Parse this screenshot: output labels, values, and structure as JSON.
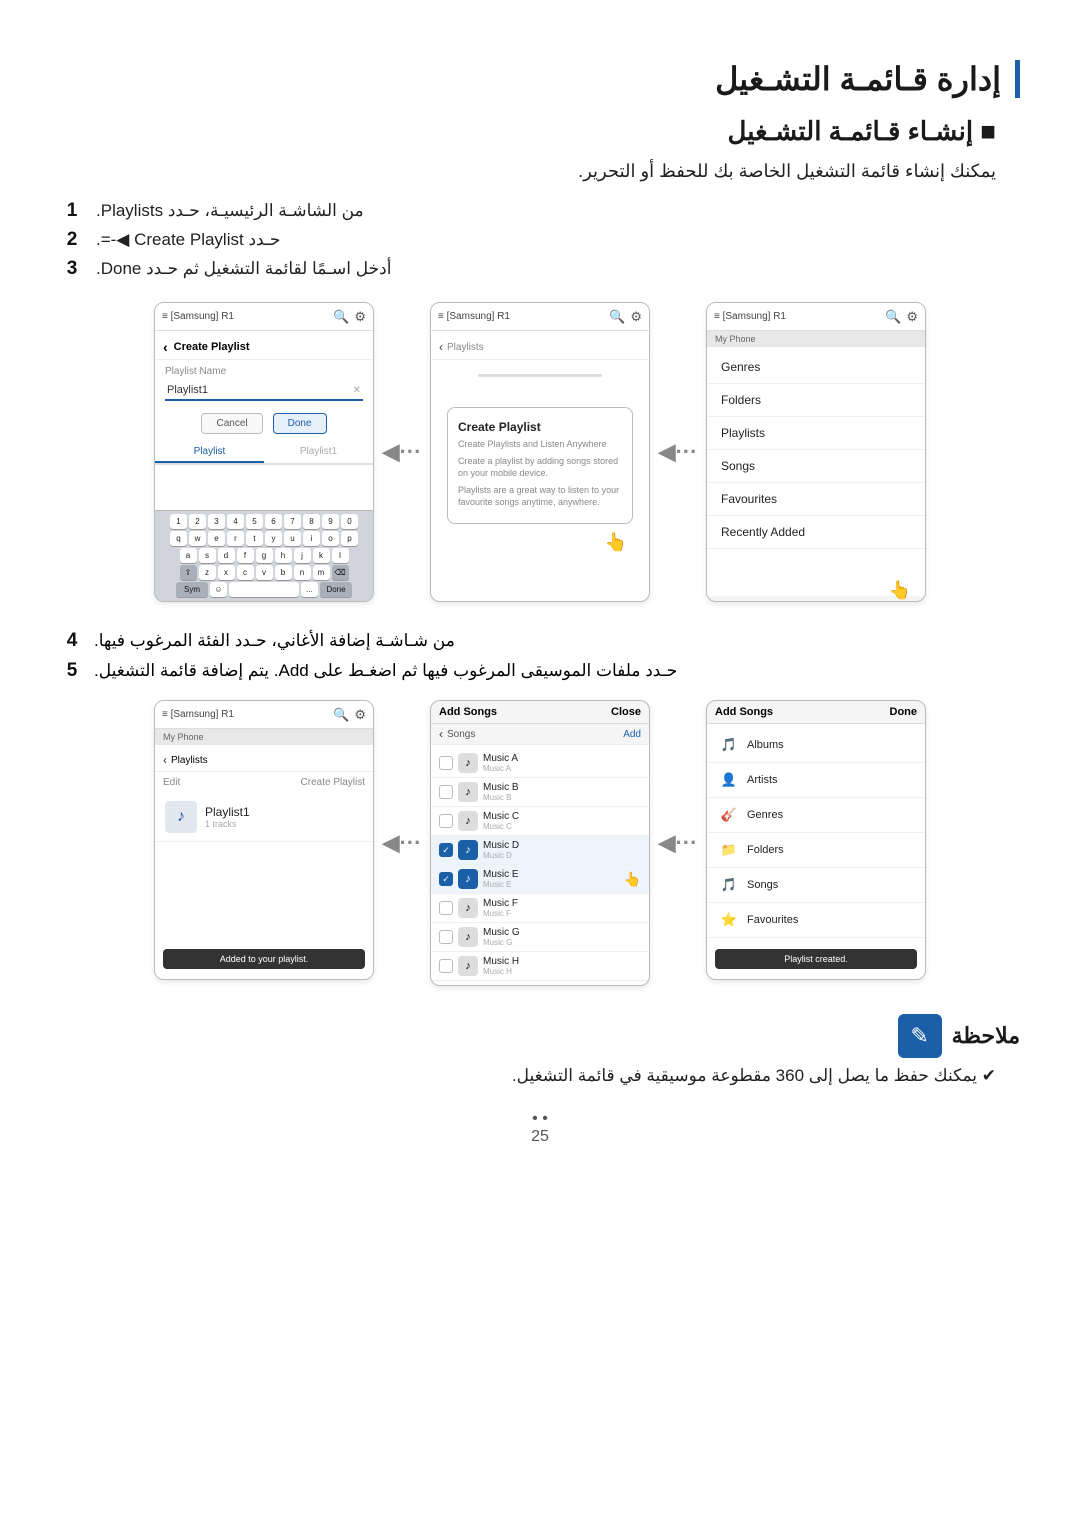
{
  "page": {
    "main_title": "إدارة قـائمـة التشـغيل",
    "section_title": "■ إنشـاء قـائمـة التشـغيل",
    "section_subtitle": "يمكنك إنشاء قائمة التشغيل الخاصة بك للحفظ أو التحرير.",
    "steps": [
      {
        "num": "1",
        "text": "من الشاشـة الرئيسيـة، حـدد Playlists."
      },
      {
        "num": "2",
        "text": "حـدد Create Playlist ◀-=."
      },
      {
        "num": "3",
        "text": "أدخل اسـمًا لقائمة التشغيل ثم حـدد Done."
      }
    ],
    "steps2": [
      {
        "num": "4",
        "text": "من شـاشـة إضافة الأغاني، حـدد الفئة المرغوب فيها."
      },
      {
        "num": "5",
        "text": "حـدد ملفات الموسيقى المرغوب فيها ثم اضغـط على Add. يتم إضافة قائمة التشغيل."
      }
    ],
    "note_label": "ملاحظة",
    "note_text": "✔ يمكنك حفظ ما يصل إلى 360 مقطوعة موسيقية في قائمة التشغيل.",
    "page_number": "25",
    "screen1": {
      "header": "≡ [Samsung] R1",
      "title": "Create Playlist",
      "label": "Playlist Name",
      "value": "Playlist1",
      "cancel": "Cancel",
      "done": "Done",
      "tab1": "Playlist",
      "tab2": "Playlist1"
    },
    "screen2": {
      "header": "≡ [Samsung] R1",
      "back": "< Playlists",
      "popup_title": "Create Playlist",
      "popup_sub1": "Create Playlists and Listen Anywhere",
      "popup_sub2": "Create a playlist by adding songs stored on your mobile device.",
      "popup_sub3": "Playlists are a great way to listen to your favourite songs anytime, anywhere."
    },
    "screen3": {
      "header": "≡ [Samsung] R1",
      "breadcrumb": "My Phone",
      "items": [
        "Genres",
        "Folders",
        "Playlists",
        "Songs",
        "Favourites",
        "Recently Added"
      ]
    },
    "screen4": {
      "header": "≡ [Samsung] R1",
      "breadcrumb": "My Phone",
      "back": "< Playlists",
      "create_btn": "Create Playlist",
      "edit_btn": "Edit",
      "playlist_name": "Playlist1",
      "playlist_count": "1 tracks",
      "toast": "Added to your playlist."
    },
    "screen5": {
      "header": "Add Songs",
      "close": "Close",
      "tab": "< Songs",
      "add_btn": "Add",
      "songs": [
        {
          "name": "Music A",
          "sub": "Music A",
          "checked": false
        },
        {
          "name": "Music B",
          "sub": "Music B",
          "checked": false
        },
        {
          "name": "Music C",
          "sub": "Music C",
          "checked": false
        },
        {
          "name": "Music D",
          "sub": "Music D",
          "checked": true
        },
        {
          "name": "Music E",
          "sub": "Music E",
          "checked": true
        },
        {
          "name": "Music F",
          "sub": "Music F",
          "checked": false
        },
        {
          "name": "Music G",
          "sub": "Music G",
          "checked": false
        },
        {
          "name": "Music H",
          "sub": "Music H",
          "checked": false
        }
      ]
    },
    "screen6": {
      "header": "Add Songs",
      "close": "Done",
      "categories": [
        {
          "icon": "🎵",
          "name": "Albums"
        },
        {
          "icon": "👤",
          "name": "Artists"
        },
        {
          "icon": "🎸",
          "name": "Genres"
        },
        {
          "icon": "📁",
          "name": "Folders"
        },
        {
          "icon": "🎵",
          "name": "Songs"
        },
        {
          "icon": "⭐",
          "name": "Favourites"
        }
      ],
      "toast": "Playlist created."
    },
    "keyboard": {
      "row1": [
        "1",
        "2",
        "3",
        "4",
        "5",
        "6",
        "7",
        "8",
        "9",
        "0"
      ],
      "row2": [
        "q",
        "w",
        "e",
        "r",
        "t",
        "y",
        "u",
        "i",
        "o",
        "p"
      ],
      "row3": [
        "a",
        "s",
        "d",
        "f",
        "g",
        "h",
        "j",
        "k",
        "l"
      ],
      "row4": [
        "⇧",
        "z",
        "x",
        "c",
        "v",
        "b",
        "n",
        "m",
        "⌫"
      ],
      "row5": [
        "Sym",
        "☺",
        "⎵",
        "...",
        "Done"
      ]
    }
  }
}
